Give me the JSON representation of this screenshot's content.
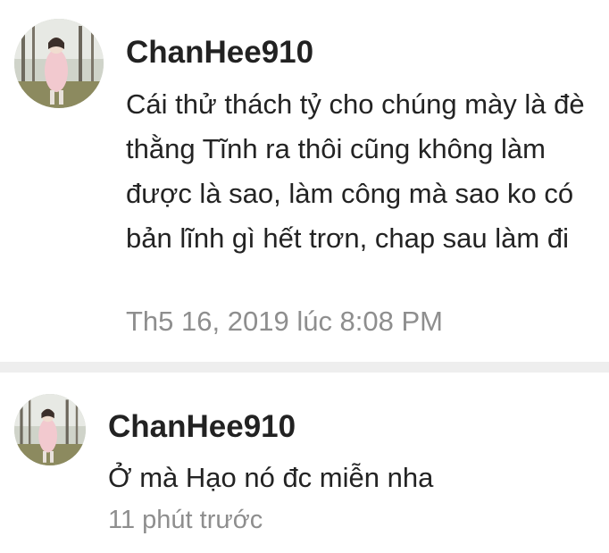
{
  "comments": [
    {
      "username": "ChanHee910",
      "text": "Cái thử thách tỷ cho chúng mày là đè thằng Tĩnh ra thôi cũng không làm được là sao, làm công mà sao ko có bản lĩnh gì hết trơn, chap sau làm đi",
      "timestamp": "Th5 16, 2019 lúc 8:08 PM"
    },
    {
      "username": "ChanHee910",
      "text": "Ở mà Hạo nó đc miễn nha",
      "timestamp": "11 phút trước"
    }
  ]
}
